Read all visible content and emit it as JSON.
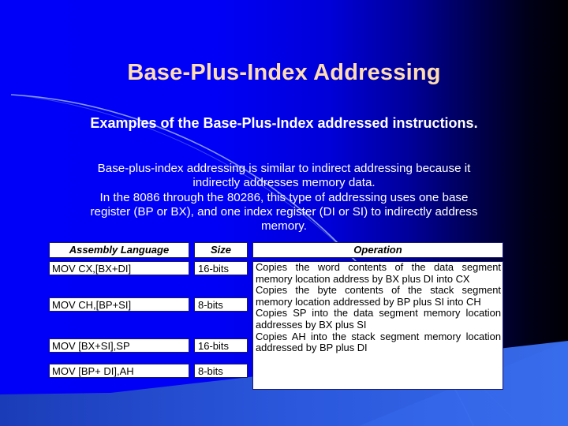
{
  "slide": {
    "title": "Base-Plus-Index Addressing",
    "subtitle": "Examples of the Base-Plus-Index addressed instructions.",
    "body_paragraphs": [
      "Base-plus-index addressing is similar to indirect addressing because it indirectly addresses memory data.",
      "In the 8086 through the 80286, this type of addressing uses one base register (BP or BX), and one index register (DI or SI) to indirectly address memory."
    ]
  },
  "table": {
    "headers": {
      "assembly": "Assembly Language",
      "size": "Size",
      "operation": "Operation"
    },
    "rows": [
      {
        "assembly": "MOV CX,[BX+DI]",
        "size": "16-bits",
        "operation": "Copies the word contents of the data segment memory location address by BX plus DI into CX"
      },
      {
        "assembly": "MOV CH,[BP+SI]",
        "size": "8-bits",
        "operation": "Copies the byte contents of the stack segment memory location addressed by BP plus SI into CH"
      },
      {
        "assembly": "MOV [BX+SI],SP",
        "size": "16-bits",
        "operation": "Copies SP into the data segment memory location addresses by BX plus SI"
      },
      {
        "assembly": "MOV [BP+ DI],AH",
        "size": "8-bits",
        "operation": "Copies AH into the stack segment memory location addressed by BP plus DI"
      }
    ]
  },
  "theme": {
    "background_left": "#0000F8",
    "background_right": "#000004",
    "title_color": "#FFDDB2",
    "text_color": "#FFFFFF",
    "accent_wedge": "#3366EE",
    "accent_arc": "#8FA8E8",
    "cell_background": "#FFFFFF",
    "cell_border": "#1A1A6E"
  }
}
